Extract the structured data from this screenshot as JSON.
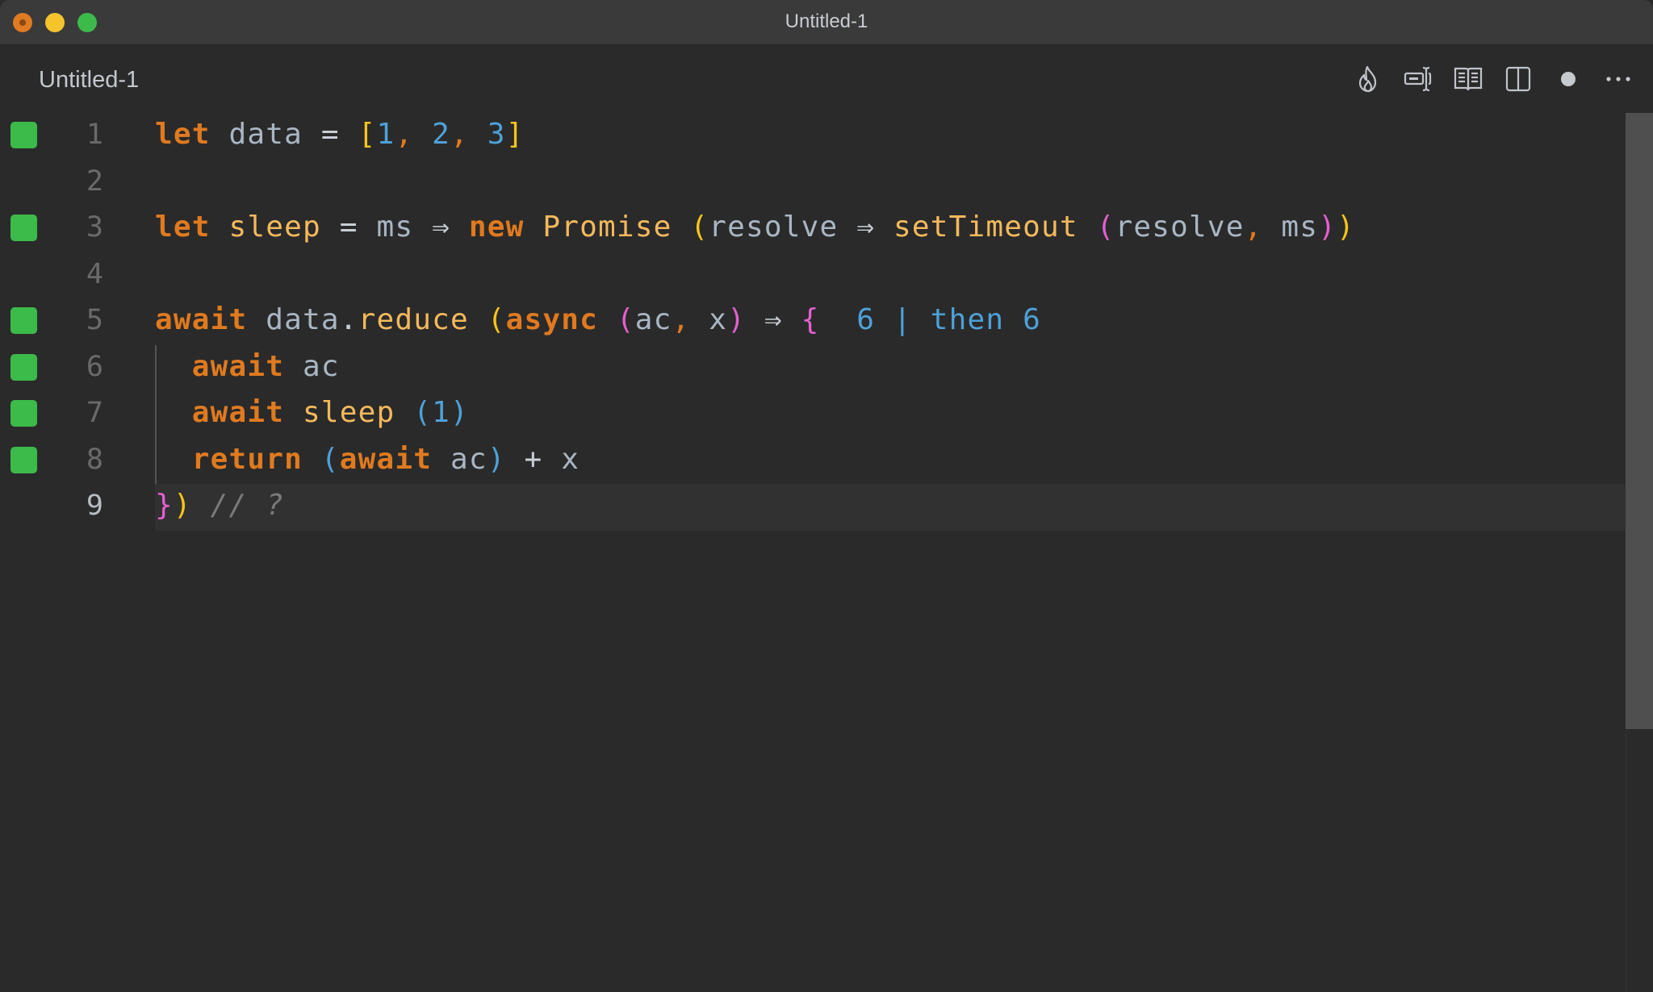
{
  "window": {
    "title": "Untitled-1",
    "traffic_lights": [
      "close",
      "minimize",
      "maximize"
    ]
  },
  "tab": {
    "label": "Untitled-1",
    "actions": [
      {
        "name": "flame-icon",
        "label": "Quokka profile"
      },
      {
        "name": "text-cursor-icon",
        "label": "Toggle value display"
      },
      {
        "name": "open-book-icon",
        "label": "Open preview"
      },
      {
        "name": "split-editor-icon",
        "label": "Split editor"
      },
      {
        "name": "unsaved-dot-icon",
        "label": "Unsaved changes"
      },
      {
        "name": "more-actions-icon",
        "label": "More actions"
      }
    ]
  },
  "editor": {
    "current_line": 9,
    "lines": [
      {
        "n": "1",
        "covered": true,
        "tokens": [
          [
            "kw",
            "let"
          ],
          [
            "sp",
            " "
          ],
          [
            "id",
            "data"
          ],
          [
            "sp",
            " "
          ],
          [
            "op",
            "="
          ],
          [
            "sp",
            " "
          ],
          [
            "b1",
            "["
          ],
          [
            "num",
            "1"
          ],
          [
            "punc",
            ","
          ],
          [
            "sp",
            " "
          ],
          [
            "num",
            "2"
          ],
          [
            "punc",
            ","
          ],
          [
            "sp",
            " "
          ],
          [
            "num",
            "3"
          ],
          [
            "b1",
            "]"
          ]
        ]
      },
      {
        "n": "2",
        "covered": false,
        "tokens": []
      },
      {
        "n": "3",
        "covered": true,
        "tokens": [
          [
            "kw",
            "let"
          ],
          [
            "sp",
            " "
          ],
          [
            "fn",
            "sleep"
          ],
          [
            "sp",
            " "
          ],
          [
            "op",
            "="
          ],
          [
            "sp",
            " "
          ],
          [
            "id",
            "ms"
          ],
          [
            "sp",
            " "
          ],
          [
            "op",
            "⇒"
          ],
          [
            "sp",
            " "
          ],
          [
            "kw",
            "new"
          ],
          [
            "sp",
            " "
          ],
          [
            "fn",
            "Promise"
          ],
          [
            "sp",
            " "
          ],
          [
            "b1",
            "("
          ],
          [
            "id",
            "resolve"
          ],
          [
            "sp",
            " "
          ],
          [
            "op",
            "⇒"
          ],
          [
            "sp",
            " "
          ],
          [
            "fn",
            "setTimeout"
          ],
          [
            "sp",
            " "
          ],
          [
            "b2",
            "("
          ],
          [
            "id",
            "resolve"
          ],
          [
            "punc",
            ","
          ],
          [
            "sp",
            " "
          ],
          [
            "id",
            "ms"
          ],
          [
            "b2",
            ")"
          ],
          [
            "b1",
            ")"
          ]
        ]
      },
      {
        "n": "4",
        "covered": false,
        "tokens": []
      },
      {
        "n": "5",
        "covered": true,
        "tokens": [
          [
            "kw",
            "await"
          ],
          [
            "sp",
            " "
          ],
          [
            "id",
            "data"
          ],
          [
            "op",
            "."
          ],
          [
            "fn",
            "reduce"
          ],
          [
            "sp",
            " "
          ],
          [
            "b1",
            "("
          ],
          [
            "kw",
            "async"
          ],
          [
            "sp",
            " "
          ],
          [
            "b2",
            "("
          ],
          [
            "id",
            "ac"
          ],
          [
            "punc",
            ","
          ],
          [
            "sp",
            " "
          ],
          [
            "id",
            "x"
          ],
          [
            "b2",
            ")"
          ],
          [
            "sp",
            " "
          ],
          [
            "op",
            "⇒"
          ],
          [
            "sp",
            " "
          ],
          [
            "b2",
            "{"
          ],
          [
            "sp",
            "  "
          ],
          [
            "res",
            "6"
          ],
          [
            "sp",
            " "
          ],
          [
            "pipe",
            "|"
          ],
          [
            "sp",
            " "
          ],
          [
            "res",
            "then 6"
          ]
        ]
      },
      {
        "n": "6",
        "covered": true,
        "tokens": [
          [
            "sp",
            "  "
          ],
          [
            "kw",
            "await"
          ],
          [
            "sp",
            " "
          ],
          [
            "id",
            "ac"
          ]
        ]
      },
      {
        "n": "7",
        "covered": true,
        "tokens": [
          [
            "sp",
            "  "
          ],
          [
            "kw",
            "await"
          ],
          [
            "sp",
            " "
          ],
          [
            "fn",
            "sleep"
          ],
          [
            "sp",
            " "
          ],
          [
            "b3",
            "("
          ],
          [
            "num",
            "1"
          ],
          [
            "b3",
            ")"
          ]
        ]
      },
      {
        "n": "8",
        "covered": true,
        "tokens": [
          [
            "sp",
            "  "
          ],
          [
            "kw",
            "return"
          ],
          [
            "sp",
            " "
          ],
          [
            "b3",
            "("
          ],
          [
            "kw",
            "await"
          ],
          [
            "sp",
            " "
          ],
          [
            "id",
            "ac"
          ],
          [
            "b3",
            ")"
          ],
          [
            "sp",
            " "
          ],
          [
            "op",
            "+"
          ],
          [
            "sp",
            " "
          ],
          [
            "id",
            "x"
          ]
        ]
      },
      {
        "n": "9",
        "covered": false,
        "tokens": [
          [
            "b2",
            "}"
          ],
          [
            "b1",
            ")"
          ],
          [
            "sp",
            " "
          ],
          [
            "cm",
            "// ?"
          ]
        ]
      }
    ],
    "inline_result": {
      "value": "6",
      "annotation": "then 6"
    }
  },
  "colors": {
    "coverage_marker": "#3cba4a",
    "keyword": "#e07a1f",
    "identifier": "#a9b6c4",
    "function": "#f5b95b",
    "number": "#4ea1d8",
    "bracket_level_1": "#f6c51b",
    "bracket_level_2": "#e45fd1",
    "bracket_level_3": "#4ea1d8",
    "comment": "#7a7a7a"
  }
}
